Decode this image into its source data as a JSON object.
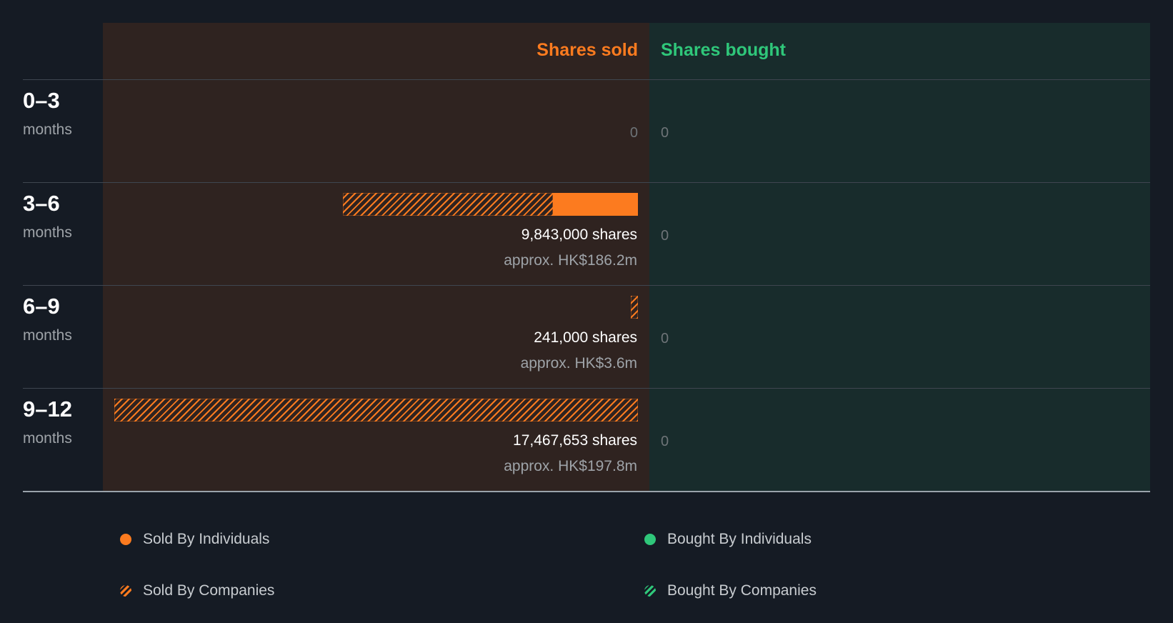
{
  "chart_data": {
    "type": "bar",
    "orientation": "horizontal-diverging",
    "headers": {
      "sold": "Shares sold",
      "bought": "Shares bought"
    },
    "periods": [
      {
        "range": "0–3",
        "unit": "months",
        "sold_individuals": 0,
        "sold_companies": 0,
        "sold_label": "0",
        "sold_value": "",
        "bought_label": "0"
      },
      {
        "range": "3–6",
        "unit": "months",
        "sold_individuals": 2830000,
        "sold_companies": 7013000,
        "sold_label": "9,843,000 shares",
        "sold_value": "approx. HK$186.2m",
        "bought_label": "0"
      },
      {
        "range": "6–9",
        "unit": "months",
        "sold_individuals": 0,
        "sold_companies": 241000,
        "sold_label": "241,000 shares",
        "sold_value": "approx. HK$3.6m",
        "bought_label": "0"
      },
      {
        "range": "9–12",
        "unit": "months",
        "sold_individuals": 0,
        "sold_companies": 17467653,
        "sold_label": "17,467,653 shares",
        "sold_value": "approx. HK$197.8m",
        "bought_label": "0"
      }
    ],
    "xlim": [
      0,
      17467653
    ],
    "legend": [
      {
        "label": "Sold By Individuals",
        "style": "solid",
        "color": "#fc7b1f"
      },
      {
        "label": "Bought By Individuals",
        "style": "solid",
        "color": "#2fc77a"
      },
      {
        "label": "Sold By Companies",
        "style": "hatched",
        "color": "#fc7b1f"
      },
      {
        "label": "Bought By Companies",
        "style": "hatched",
        "color": "#2fc77a"
      }
    ],
    "legend_position": "bottom",
    "colors": {
      "sold": "#fc7b1f",
      "bought": "#2fc77a",
      "background": "#151b24"
    }
  }
}
